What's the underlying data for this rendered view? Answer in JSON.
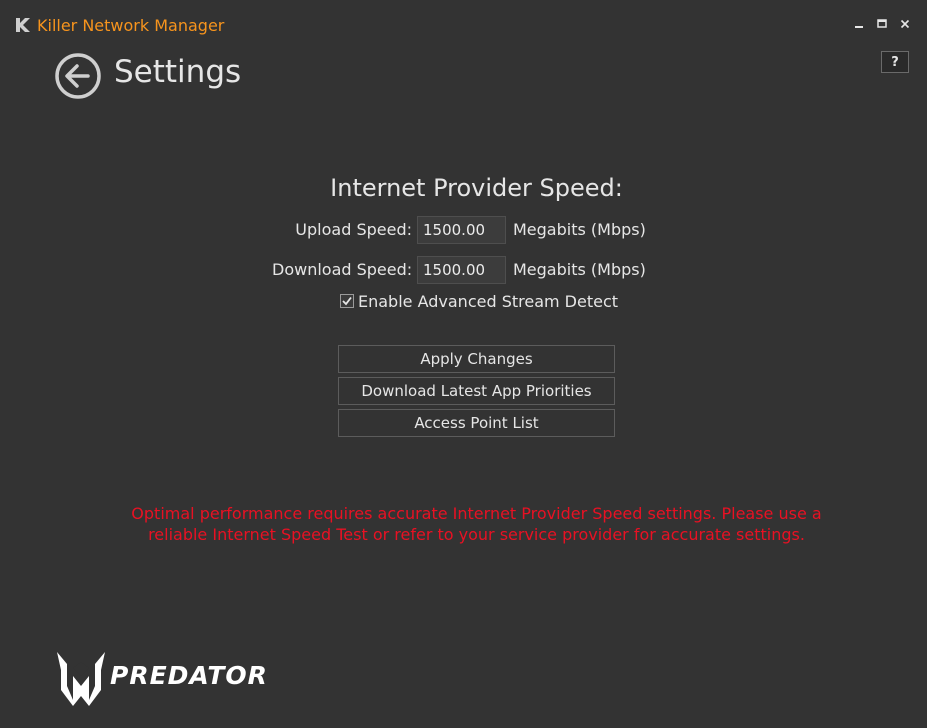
{
  "window": {
    "title": "Killer Network Manager",
    "controls": {
      "minimize_icon": "minimize-icon",
      "maximize_icon": "maximize-icon",
      "close_icon": "close-icon"
    }
  },
  "header": {
    "back_icon": "back-arrow-circle-icon",
    "title": "Settings",
    "help_label": "?"
  },
  "speed": {
    "heading": "Internet Provider Speed:",
    "upload_label": "Upload Speed:",
    "upload_value": "1500.00",
    "upload_unit": "Megabits (Mbps)",
    "download_label": "Download Speed:",
    "download_value": "1500.00",
    "download_unit": "Megabits (Mbps)",
    "stream_detect_label": "Enable Advanced Stream Detect",
    "stream_detect_checked": true
  },
  "actions": {
    "apply": "Apply Changes",
    "download_priorities": "Download Latest App Priorities",
    "access_points": "Access Point List"
  },
  "warning": {
    "line1": "Optimal performance requires accurate Internet Provider Speed settings. Please use a",
    "line2": "reliable Internet Speed Test or refer to your service provider for accurate settings."
  },
  "branding": {
    "name": "PREDATOR"
  },
  "colors": {
    "background": "#333333",
    "title_accent": "#f7941d",
    "warning": "#e81123",
    "text": "#e6e6e6"
  }
}
